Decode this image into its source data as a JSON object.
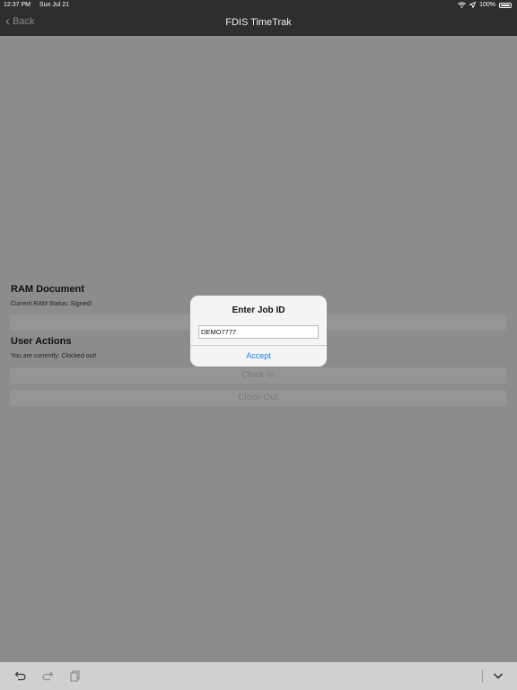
{
  "status_bar": {
    "time": "12:37 PM",
    "date": "Sun Jul 21",
    "battery": "100%",
    "icons": [
      "wifi-icon",
      "location-icon",
      "battery-icon"
    ]
  },
  "nav": {
    "back_label": "Back",
    "title": "FDIS TimeTrak"
  },
  "ram_document": {
    "title": "RAM Document",
    "status": "Current RAM Status: Signed!"
  },
  "user_actions": {
    "title": "User Actions",
    "status": "You are currently: Clocked out!",
    "clock_in_label": "Clock-In",
    "clock_out_label": "Clock-Out"
  },
  "dialog": {
    "title": "Enter Job ID",
    "input_value": "DEMO7777",
    "accept_label": "Accept"
  },
  "toolbar": {
    "icons": [
      "undo-icon",
      "redo-icon",
      "paste-icon",
      "chevron-down-icon"
    ]
  },
  "colors": {
    "accent": "#1e7ee0",
    "nav_background": "#2e2e2e",
    "dim_overlay": "#8c8c8c"
  }
}
